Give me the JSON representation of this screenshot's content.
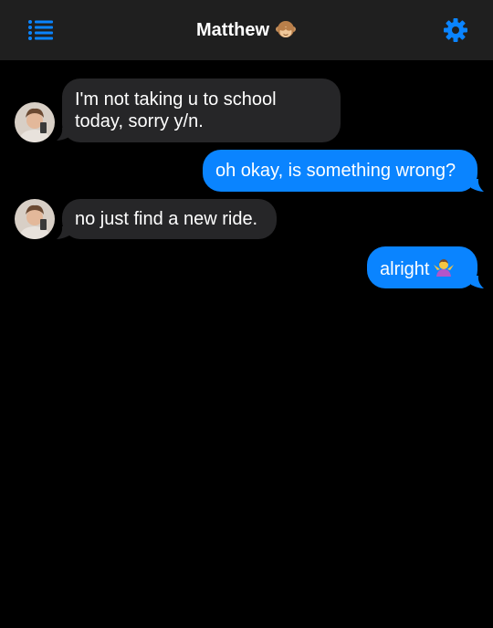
{
  "header": {
    "title": "Matthew",
    "title_emoji": "see-no-evil-monkey-emoji",
    "menu_icon": "list-icon",
    "settings_icon": "gear-icon"
  },
  "colors": {
    "background": "#000000",
    "header_background": "#1f1f1f",
    "incoming_bubble": "#262628",
    "outgoing_bubble": "#0a84ff",
    "accent": "#0a84ff"
  },
  "messages": [
    {
      "direction": "incoming",
      "lines": [
        "I'm not taking u to school",
        "today, sorry y/n."
      ]
    },
    {
      "direction": "outgoing",
      "text": "oh okay, is something wrong?"
    },
    {
      "direction": "incoming",
      "text": "no just find a new ride."
    },
    {
      "direction": "outgoing",
      "text": "alright",
      "emoji": "person-shrugging-emoji"
    }
  ]
}
